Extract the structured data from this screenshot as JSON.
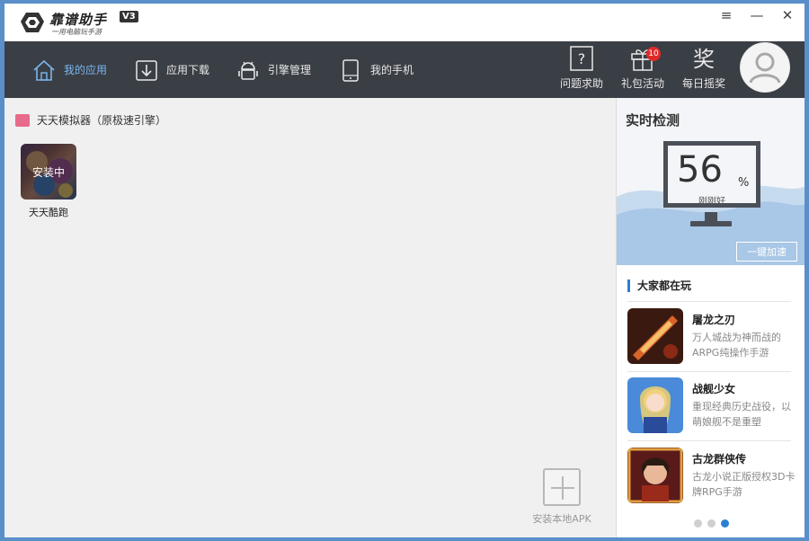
{
  "app": {
    "name": "靠谱助手",
    "version": "V3",
    "slogan": "一用电脑玩手游"
  },
  "window_controls": {
    "menu": "≡",
    "minimize": "—",
    "close": "✕"
  },
  "nav": {
    "tabs": [
      {
        "label": "我的应用",
        "icon": "home-icon",
        "active": true
      },
      {
        "label": "应用下载",
        "icon": "download-icon",
        "active": false
      },
      {
        "label": "引擎管理",
        "icon": "android-icon",
        "active": false
      },
      {
        "label": "我的手机",
        "icon": "phone-icon",
        "active": false
      }
    ],
    "right": [
      {
        "label": "问题求助",
        "icon": "help-icon"
      },
      {
        "label": "礼包活动",
        "icon": "gift-icon",
        "badge": "10"
      },
      {
        "label": "每日摇奖",
        "icon": "lottery-icon"
      }
    ]
  },
  "main": {
    "section_title": "天天模拟器（原极速引擎）",
    "apps": [
      {
        "name": "天天酷跑",
        "status": "安装中"
      }
    ],
    "install_apk_label": "安装本地APK"
  },
  "monitor": {
    "title": "实时检测",
    "value": "56",
    "unit": "%",
    "state": "刚刚好",
    "button": "一键加速"
  },
  "popular": {
    "title": "大家都在玩",
    "games": [
      {
        "title": "屠龙之刃",
        "desc": "万人城战为神而战的ARPG纯操作手游"
      },
      {
        "title": "战舰少女",
        "desc": "重现经典历史战役，以萌娘舰不是重塑"
      },
      {
        "title": "古龙群侠传",
        "desc": "古龙小说正版授权3D卡牌RPG手游"
      }
    ],
    "page_count": 3,
    "active_page": 3
  },
  "colors": {
    "nav_bg": "#3a3e45",
    "accent": "#2a7fd4",
    "active_tab": "#7bb6ee",
    "badge": "#e02a2a"
  }
}
